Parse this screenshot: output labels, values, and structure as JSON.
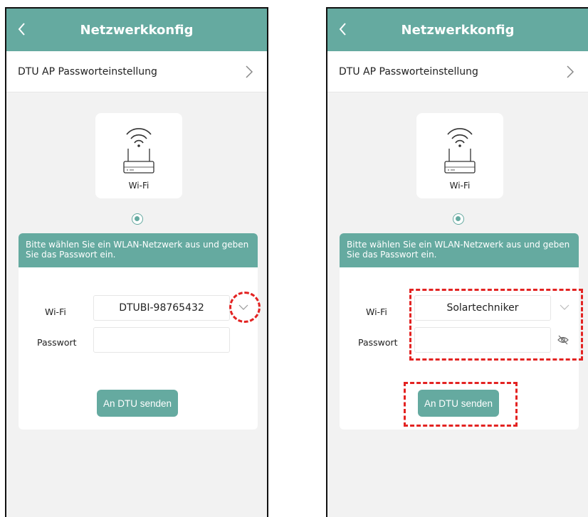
{
  "header": {
    "title": "Netzwerkkonfig"
  },
  "config_row": {
    "label": "DTU AP Passworteinstellung"
  },
  "wifi_card": {
    "label": "Wi-Fi"
  },
  "form": {
    "instructions": "Bitte wählen Sie ein WLAN-Netzwerk aus und geben Sie das Passwort ein.",
    "wifi_label": "Wi-Fi",
    "password_label": "Passwort",
    "send_label": "An DTU senden"
  },
  "left_screen": {
    "wifi_value": "DTUBI-98765432",
    "password_value": ""
  },
  "right_screen": {
    "wifi_value": "Solartechniker",
    "password_value": ""
  },
  "colors": {
    "accent": "#65aaa0",
    "highlight": "#e32322"
  },
  "icons": [
    "back-icon",
    "chevron-right-icon",
    "router-wifi-icon",
    "chevron-down-icon",
    "eye-off-icon"
  ]
}
